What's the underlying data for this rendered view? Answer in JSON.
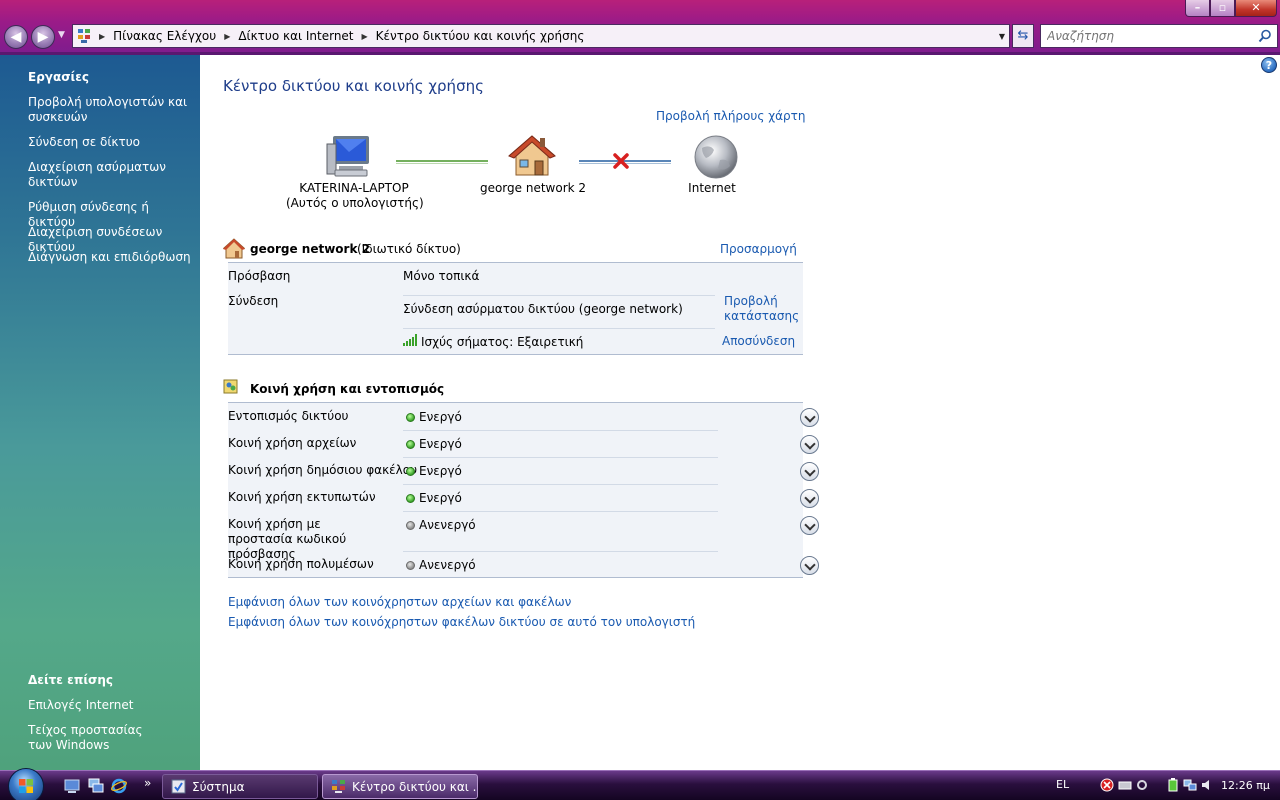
{
  "window": {
    "breadcrumbs": [
      "Πίνακας Ελέγχου",
      "Δίκτυο και Internet",
      "Κέντρο δικτύου και κοινής χρήσης"
    ],
    "search_placeholder": "Αναζήτηση"
  },
  "sidebar": {
    "tasks_heading": "Εργασίες",
    "tasks": [
      "Προβολή υπολογιστών και συσκευών",
      "Σύνδεση σε δίκτυο",
      "Διαχείριση ασύρματων δικτύων",
      "Ρύθμιση σύνδεσης ή δικτύου",
      "Διαχείριση συνδέσεων δικτύου",
      "Διάγνωση και επιδιόρθωση"
    ],
    "see_also_heading": "Δείτε επίσης",
    "see_also": [
      "Επιλογές Internet",
      "Τείχος προστασίας των Windows"
    ]
  },
  "main": {
    "title": "Κέντρο δικτύου και κοινής χρήσης",
    "full_map_link": "Προβολή πλήρους χάρτη",
    "map": {
      "computer_name": "KATERINA-LAPTOP",
      "computer_sub": "(Αυτός ο υπολογιστής)",
      "network_name": "george network  2",
      "internet_label": "Internet"
    },
    "network": {
      "name": "george network  2",
      "type": "(Ιδιωτικό δίκτυο)",
      "customize_link": "Προσαρμογή",
      "access_label": "Πρόσβαση",
      "access_value": "Μόνο τοπικά",
      "connection_label": "Σύνδεση",
      "connection_value": "Σύνδεση ασύρματου δικτύου (george network)",
      "view_status_link": "Προβολή κατάστασης",
      "signal_value": "Ισχύς σήματος: Εξαιρετική",
      "disconnect_link": "Αποσύνδεση"
    },
    "sharing": {
      "title": "Κοινή χρήση και εντοπισμός",
      "rows": [
        {
          "label": "Εντοπισμός δικτύου",
          "status": "Ενεργό",
          "on": true
        },
        {
          "label": "Κοινή χρήση αρχείων",
          "status": "Ενεργό",
          "on": true
        },
        {
          "label": "Κοινή χρήση δημόσιου φακέλου",
          "status": "Ενεργό",
          "on": true
        },
        {
          "label": "Κοινή χρήση εκτυπωτών",
          "status": "Ενεργό",
          "on": true
        },
        {
          "label": "Κοινή χρήση με προστασία κωδικού πρόσβασης",
          "status": "Ανενεργό",
          "on": false
        },
        {
          "label": "Κοινή χρήση πολυμέσων",
          "status": "Ανενεργό",
          "on": false
        }
      ]
    },
    "links": [
      "Εμφάνιση όλων των κοινόχρηστων αρχείων και φακέλων",
      "Εμφάνιση όλων των κοινόχρηστων φακέλων δικτύου σε αυτό τον υπολογιστή"
    ]
  },
  "taskbar": {
    "tasks": [
      "Σύστημα",
      "Κέντρο δικτύου και ..."
    ],
    "language": "EL",
    "clock": "12:26 πμ"
  }
}
